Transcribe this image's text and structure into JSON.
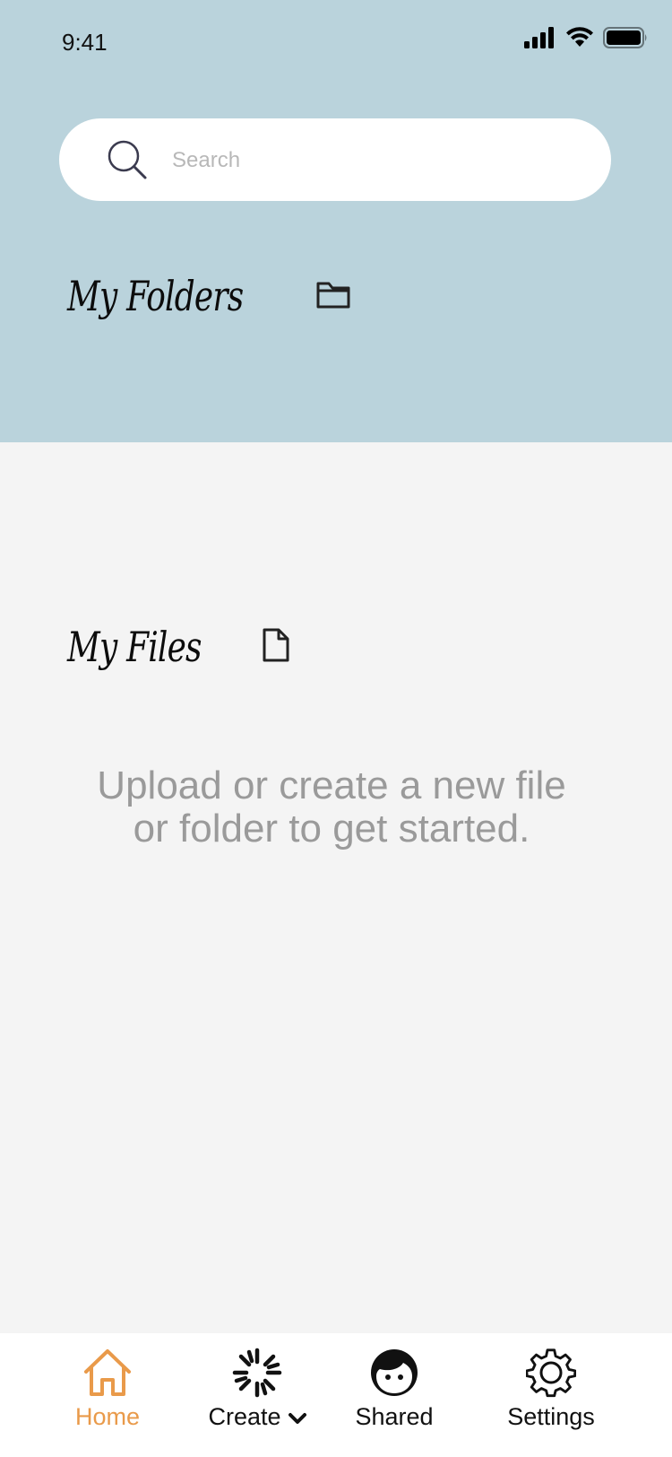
{
  "status_bar": {
    "time": "9:41"
  },
  "search": {
    "placeholder": "Search"
  },
  "folders": {
    "title": "My Folders",
    "icon": "folder-icon"
  },
  "files": {
    "title": "My Files",
    "icon": "file-icon",
    "empty_message": "Upload or create a new file or folder to get started."
  },
  "bottom_nav": {
    "items": [
      {
        "label": "Home",
        "icon": "home-icon",
        "active": true
      },
      {
        "label": "Create",
        "icon": "sparkle-icon",
        "active": false
      },
      {
        "label": "Shared",
        "icon": "face-icon",
        "active": false
      },
      {
        "label": "Settings",
        "icon": "gear-icon",
        "active": false
      }
    ]
  },
  "colors": {
    "top_panel": "#bad3dc",
    "background": "#f4f4f4",
    "accent": "#e99a4a",
    "muted_text": "#9a9a9a"
  }
}
